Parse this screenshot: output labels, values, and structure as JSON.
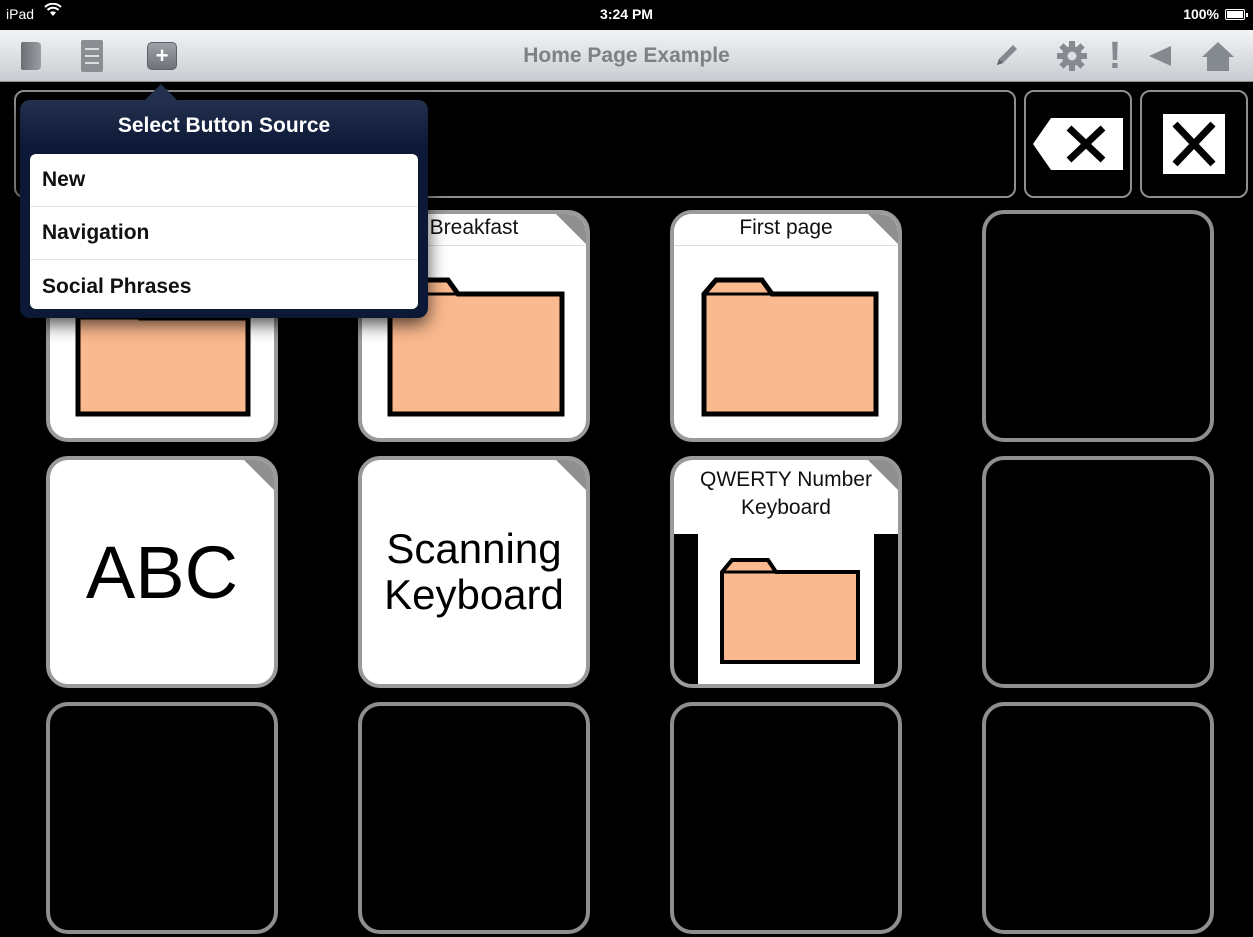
{
  "status_bar": {
    "device": "iPad",
    "time": "3:24 PM",
    "battery": "100%"
  },
  "toolbar": {
    "title": "Home Page Example",
    "left_icons": [
      "book-icon",
      "file-cabinet-icon",
      "add-icon"
    ],
    "add_symbol": "+",
    "right_icons": [
      "pencil-icon",
      "gear-icon",
      "exclamation-icon",
      "back-arrow-icon",
      "home-icon"
    ],
    "exclaim_symbol": "!"
  },
  "popover": {
    "title": "Select Button Source",
    "items": [
      "New",
      "Navigation",
      "Social Phrases"
    ]
  },
  "grid": {
    "rows": [
      [
        {
          "label": "",
          "icon": "folder-icon"
        },
        {
          "label": "Breakfast",
          "icon": "folder-icon"
        },
        {
          "label": "First page",
          "icon": "folder-icon"
        },
        {
          "label": "",
          "icon": ""
        }
      ],
      [
        {
          "label": "ABC",
          "icon": ""
        },
        {
          "label": "Scanning\nKeyboard",
          "icon": ""
        },
        {
          "label": "QWERTY Number Keyboard",
          "icon": "folder-icon"
        },
        {
          "label": "",
          "icon": ""
        }
      ],
      [
        {
          "label": "",
          "icon": ""
        },
        {
          "label": "",
          "icon": ""
        },
        {
          "label": "",
          "icon": ""
        },
        {
          "label": "",
          "icon": ""
        }
      ]
    ]
  },
  "colors": {
    "folder_fill": "#fbb98f",
    "popover_header": "#0b1836",
    "cell_border": "#8e8e8e",
    "toolbar_text": "#7d8185"
  }
}
